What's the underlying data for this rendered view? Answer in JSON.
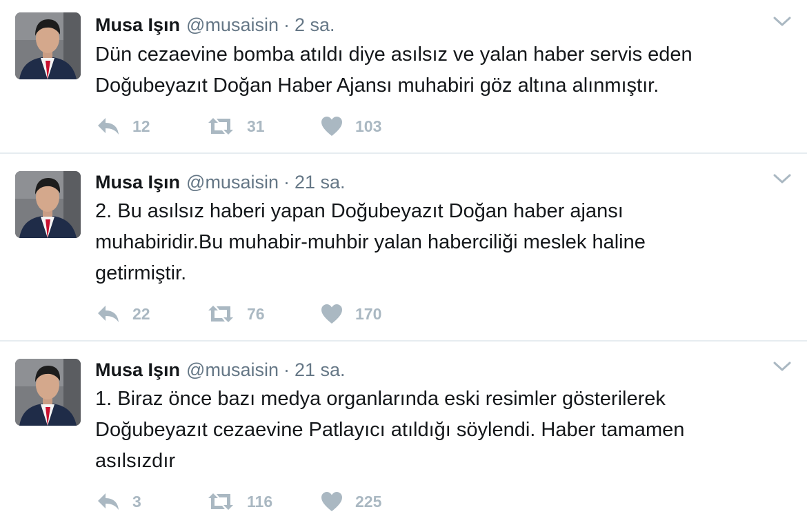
{
  "tweets": [
    {
      "name": "Musa Işın",
      "handle": "@musaisin",
      "separator": "·",
      "time": "2 sa.",
      "text": "Dün cezaevine bomba atıldı diye asılsız ve yalan haber servis eden Doğubeyazıt Doğan Haber Ajansı muhabiri göz altına alınmıştır.",
      "reply_count": "12",
      "retweet_count": "31",
      "like_count": "103"
    },
    {
      "name": "Musa Işın",
      "handle": "@musaisin",
      "separator": "·",
      "time": "21 sa.",
      "text": "2. Bu asılsız haberi yapan Doğubeyazıt Doğan haber ajansı muhabiridir.Bu muhabir-muhbir yalan haberciliği meslek haline getirmiştir.",
      "reply_count": "22",
      "retweet_count": "76",
      "like_count": "170"
    },
    {
      "name": "Musa Işın",
      "handle": "@musaisin",
      "separator": "·",
      "time": "21 sa.",
      "text": "1. Biraz önce bazı medya organlarında eski resimler gösterilerek Doğubeyazıt cezaevine Patlayıcı atıldığı söylendi. Haber tamamen asılsızdır",
      "reply_count": "3",
      "retweet_count": "116",
      "like_count": "225"
    }
  ],
  "icons": {
    "reply": "reply-icon",
    "retweet": "retweet-icon",
    "like": "heart-icon",
    "menu": "chevron-down-icon"
  },
  "colors": {
    "name": "#14171a",
    "secondary": "#657786",
    "action": "#aab8c2",
    "divider": "#e6ecf0"
  }
}
